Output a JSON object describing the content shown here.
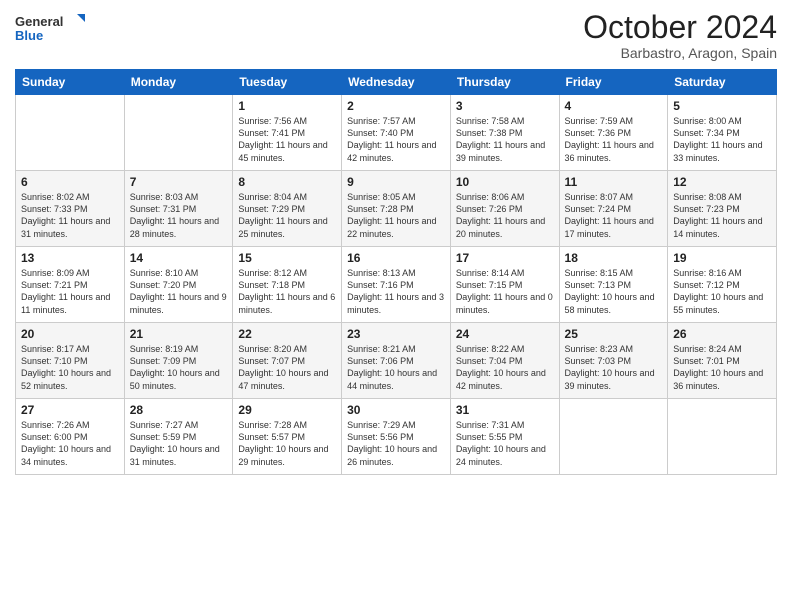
{
  "logo": {
    "line1": "General",
    "line2": "Blue"
  },
  "title": "October 2024",
  "subtitle": "Barbastro, Aragon, Spain",
  "weekdays": [
    "Sunday",
    "Monday",
    "Tuesday",
    "Wednesday",
    "Thursday",
    "Friday",
    "Saturday"
  ],
  "weeks": [
    [
      {
        "day": "",
        "info": ""
      },
      {
        "day": "",
        "info": ""
      },
      {
        "day": "1",
        "info": "Sunrise: 7:56 AM\nSunset: 7:41 PM\nDaylight: 11 hours and 45 minutes."
      },
      {
        "day": "2",
        "info": "Sunrise: 7:57 AM\nSunset: 7:40 PM\nDaylight: 11 hours and 42 minutes."
      },
      {
        "day": "3",
        "info": "Sunrise: 7:58 AM\nSunset: 7:38 PM\nDaylight: 11 hours and 39 minutes."
      },
      {
        "day": "4",
        "info": "Sunrise: 7:59 AM\nSunset: 7:36 PM\nDaylight: 11 hours and 36 minutes."
      },
      {
        "day": "5",
        "info": "Sunrise: 8:00 AM\nSunset: 7:34 PM\nDaylight: 11 hours and 33 minutes."
      }
    ],
    [
      {
        "day": "6",
        "info": "Sunrise: 8:02 AM\nSunset: 7:33 PM\nDaylight: 11 hours and 31 minutes."
      },
      {
        "day": "7",
        "info": "Sunrise: 8:03 AM\nSunset: 7:31 PM\nDaylight: 11 hours and 28 minutes."
      },
      {
        "day": "8",
        "info": "Sunrise: 8:04 AM\nSunset: 7:29 PM\nDaylight: 11 hours and 25 minutes."
      },
      {
        "day": "9",
        "info": "Sunrise: 8:05 AM\nSunset: 7:28 PM\nDaylight: 11 hours and 22 minutes."
      },
      {
        "day": "10",
        "info": "Sunrise: 8:06 AM\nSunset: 7:26 PM\nDaylight: 11 hours and 20 minutes."
      },
      {
        "day": "11",
        "info": "Sunrise: 8:07 AM\nSunset: 7:24 PM\nDaylight: 11 hours and 17 minutes."
      },
      {
        "day": "12",
        "info": "Sunrise: 8:08 AM\nSunset: 7:23 PM\nDaylight: 11 hours and 14 minutes."
      }
    ],
    [
      {
        "day": "13",
        "info": "Sunrise: 8:09 AM\nSunset: 7:21 PM\nDaylight: 11 hours and 11 minutes."
      },
      {
        "day": "14",
        "info": "Sunrise: 8:10 AM\nSunset: 7:20 PM\nDaylight: 11 hours and 9 minutes."
      },
      {
        "day": "15",
        "info": "Sunrise: 8:12 AM\nSunset: 7:18 PM\nDaylight: 11 hours and 6 minutes."
      },
      {
        "day": "16",
        "info": "Sunrise: 8:13 AM\nSunset: 7:16 PM\nDaylight: 11 hours and 3 minutes."
      },
      {
        "day": "17",
        "info": "Sunrise: 8:14 AM\nSunset: 7:15 PM\nDaylight: 11 hours and 0 minutes."
      },
      {
        "day": "18",
        "info": "Sunrise: 8:15 AM\nSunset: 7:13 PM\nDaylight: 10 hours and 58 minutes."
      },
      {
        "day": "19",
        "info": "Sunrise: 8:16 AM\nSunset: 7:12 PM\nDaylight: 10 hours and 55 minutes."
      }
    ],
    [
      {
        "day": "20",
        "info": "Sunrise: 8:17 AM\nSunset: 7:10 PM\nDaylight: 10 hours and 52 minutes."
      },
      {
        "day": "21",
        "info": "Sunrise: 8:19 AM\nSunset: 7:09 PM\nDaylight: 10 hours and 50 minutes."
      },
      {
        "day": "22",
        "info": "Sunrise: 8:20 AM\nSunset: 7:07 PM\nDaylight: 10 hours and 47 minutes."
      },
      {
        "day": "23",
        "info": "Sunrise: 8:21 AM\nSunset: 7:06 PM\nDaylight: 10 hours and 44 minutes."
      },
      {
        "day": "24",
        "info": "Sunrise: 8:22 AM\nSunset: 7:04 PM\nDaylight: 10 hours and 42 minutes."
      },
      {
        "day": "25",
        "info": "Sunrise: 8:23 AM\nSunset: 7:03 PM\nDaylight: 10 hours and 39 minutes."
      },
      {
        "day": "26",
        "info": "Sunrise: 8:24 AM\nSunset: 7:01 PM\nDaylight: 10 hours and 36 minutes."
      }
    ],
    [
      {
        "day": "27",
        "info": "Sunrise: 7:26 AM\nSunset: 6:00 PM\nDaylight: 10 hours and 34 minutes."
      },
      {
        "day": "28",
        "info": "Sunrise: 7:27 AM\nSunset: 5:59 PM\nDaylight: 10 hours and 31 minutes."
      },
      {
        "day": "29",
        "info": "Sunrise: 7:28 AM\nSunset: 5:57 PM\nDaylight: 10 hours and 29 minutes."
      },
      {
        "day": "30",
        "info": "Sunrise: 7:29 AM\nSunset: 5:56 PM\nDaylight: 10 hours and 26 minutes."
      },
      {
        "day": "31",
        "info": "Sunrise: 7:31 AM\nSunset: 5:55 PM\nDaylight: 10 hours and 24 minutes."
      },
      {
        "day": "",
        "info": ""
      },
      {
        "day": "",
        "info": ""
      }
    ]
  ]
}
